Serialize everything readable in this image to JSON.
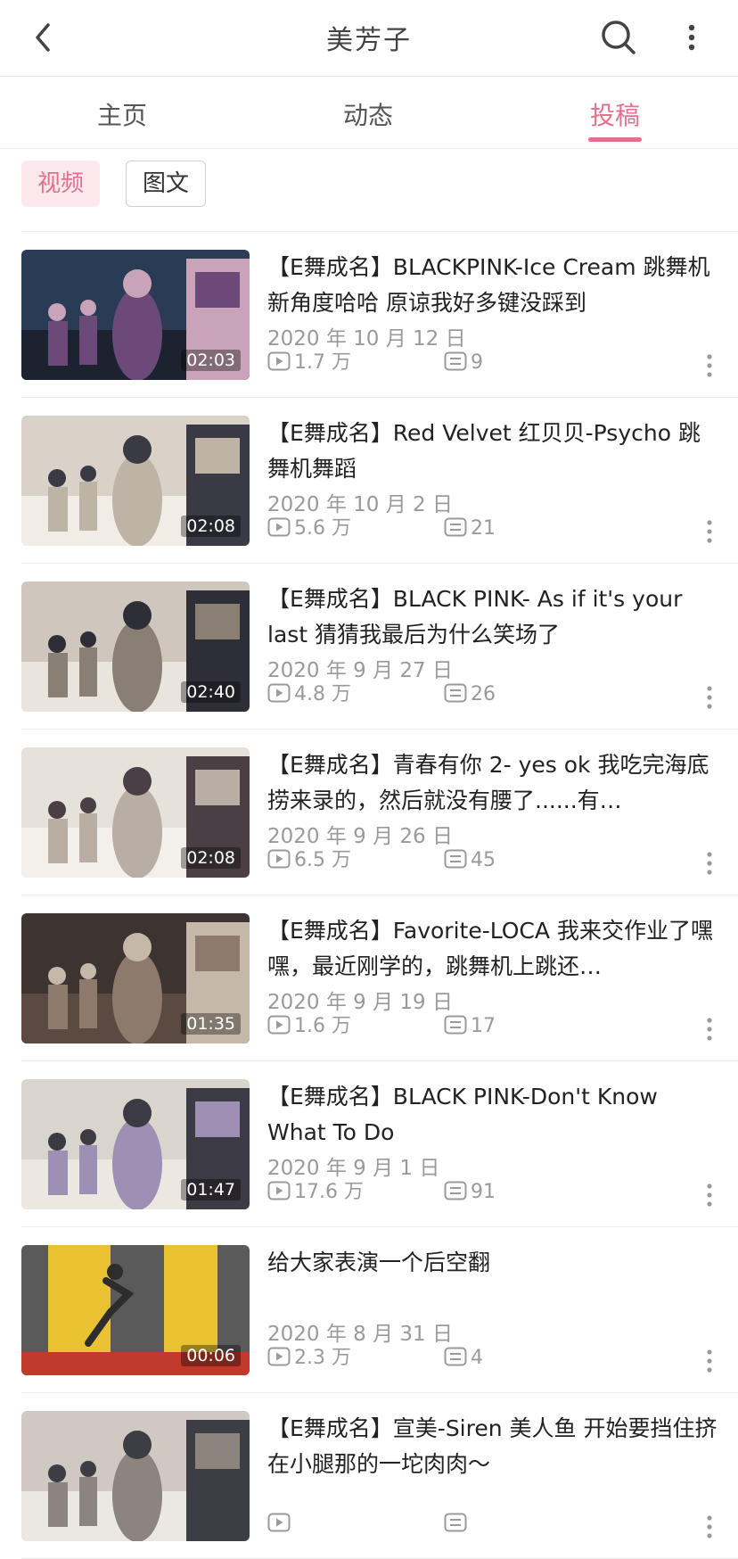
{
  "header": {
    "title": "美芳子",
    "icons": [
      "back-icon",
      "search-icon",
      "more-icon"
    ]
  },
  "tabs": [
    {
      "label": "主页"
    },
    {
      "label": "动态"
    },
    {
      "label": "投稿",
      "active": true
    }
  ],
  "filters": {
    "video": "视频",
    "graphic": "图文",
    "selected": "视频"
  },
  "colors": {
    "accent": "#e2708f",
    "chip_bg": "#fde8ee",
    "meta_text": "#9a9a9a"
  },
  "videos": [
    {
      "title": "【E舞成名】BLACKPINK-Ice Cream  跳舞机新角度哈哈  原谅我好多键没踩到",
      "duration": "02:03",
      "date": "2020 年 10 月 12 日",
      "plays": "1.7 万",
      "comments": "9"
    },
    {
      "title": "【E舞成名】Red Velvet 红贝贝-Psycho 跳舞机舞蹈",
      "duration": "02:08",
      "date": "2020 年 10 月 2 日",
      "plays": "5.6 万",
      "comments": "21"
    },
    {
      "title": "【E舞成名】BLACK PINK- As if it's your last 猜猜我最后为什么笑场了",
      "duration": "02:40",
      "date": "2020 年 9 月 27 日",
      "plays": "4.8 万",
      "comments": "26"
    },
    {
      "title": "【E舞成名】青春有你 2- yes ok 我吃完海底捞来录的，然后就没有腰了......有…",
      "duration": "02:08",
      "date": "2020 年 9 月 26 日",
      "plays": "6.5 万",
      "comments": "45"
    },
    {
      "title": "【E舞成名】Favorite-LOCA 我来交作业了嘿嘿，最近刚学的，跳舞机上跳还…",
      "duration": "01:35",
      "date": "2020 年 9 月 19 日",
      "plays": "1.6 万",
      "comments": "17"
    },
    {
      "title": "【E舞成名】BLACK PINK-Don't Know What To Do",
      "duration": "01:47",
      "date": "2020 年 9 月 1 日",
      "plays": "17.6 万",
      "comments": "91"
    },
    {
      "title": "给大家表演一个后空翻",
      "duration": "00:06",
      "date": "2020 年 8 月 31 日",
      "plays": "2.3 万",
      "comments": "4"
    },
    {
      "title": "【E舞成名】宣美-Siren 美人鱼  开始要挡住挤在小腿那的一坨肉肉～",
      "duration": "",
      "date": "",
      "plays": "",
      "comments": ""
    }
  ]
}
